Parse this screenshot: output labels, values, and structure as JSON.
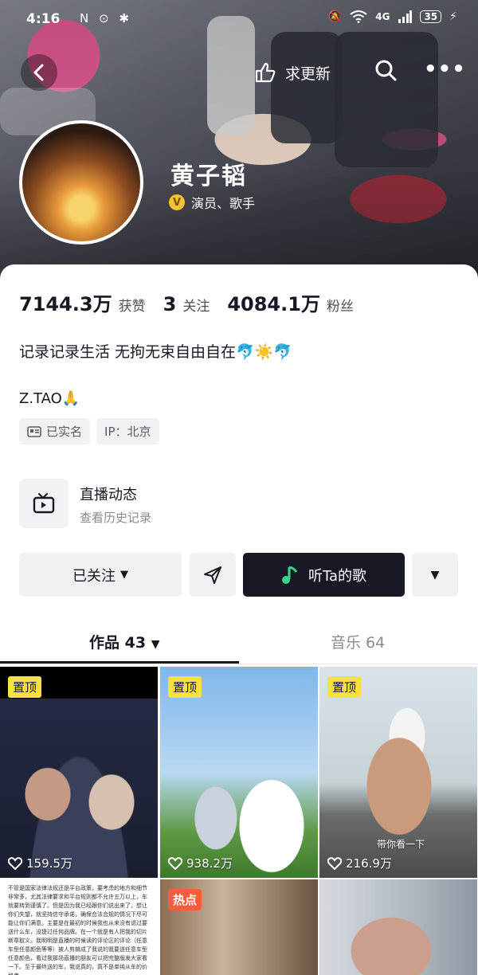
{
  "status_bar": {
    "time": "4:16",
    "left_icons": "N ⊙ ✱",
    "network": "4G",
    "battery": "35"
  },
  "header": {
    "update_label": "求更新"
  },
  "profile": {
    "name": "黄子韬",
    "verification": "演员、歌手"
  },
  "stats": [
    {
      "value": "7144.3万",
      "label": "获赞"
    },
    {
      "value": "3",
      "label": "关注"
    },
    {
      "value": "4084.1万",
      "label": "粉丝"
    }
  ],
  "bio": {
    "line1": "记录记录生活 无拘无束自由自在🐬☀️🐬",
    "line2": "Z.TAO🙏",
    "tags": [
      "已实名",
      "IP：北京"
    ]
  },
  "live": {
    "title": "直播动态",
    "subtitle": "查看历史记录"
  },
  "actions": {
    "followed_label": "已关注",
    "music_label": "听Ta的歌"
  },
  "tabs": {
    "works_label": "作品 43",
    "music_label": "音乐 64"
  },
  "grid": [
    {
      "badge": "置顶",
      "likes": "159.5万"
    },
    {
      "badge": "置顶",
      "likes": "938.2万"
    },
    {
      "badge": "置顶",
      "likes": "216.9万"
    },
    {
      "badge": "",
      "likes": ""
    },
    {
      "badge": "热点",
      "likes": ""
    },
    {
      "badge": "",
      "likes": ""
    }
  ],
  "grid_text": {
    "doc_text": "不管是国家法律法规还是平台政策，要考虑的地方和细节非常多，尤其法律要求和平台规则都不允许五万以上，车就要转到谨慎了。但是因为我已经跟你们说出来了，想让你们失望，就坚持信守承诺，确保合法合规的情况下尽可能让你们满意。主要是在最初的时候我也从来没有说过要送什么车，没提过任何品牌。在一个就是有人把我的切片断章取义。我明明是直播的时候读的评论区的评论（任意车型任意颜色等等）被人剪辑成了我说的我要送任意车型任意颜色，看过我那场直播的朋友可以把完整版发大家看一下。至于最终送的车，我说真的，真不是单纯从车的价格考",
    "t3_overlay": "带你看一下"
  },
  "colors": {
    "dark": "#161823",
    "pin_yellow": "#fbe042",
    "hot_red": "#fe5c3c",
    "music_green": "#36d68a"
  }
}
